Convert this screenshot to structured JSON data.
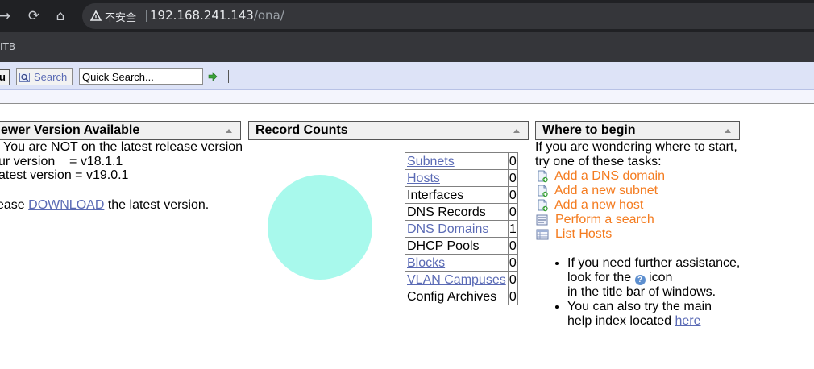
{
  "browser": {
    "nav": {
      "forward_glyph": "→",
      "reload_glyph": "⟳",
      "home_glyph": "⌂"
    },
    "security_label": "不安全",
    "url_host": "192.168.241.143",
    "url_path": "/ona/",
    "bookmark_partial": "ITB"
  },
  "toolbar": {
    "menu_label": "u",
    "search_label": "Search",
    "quick_search_value": "Quick Search..."
  },
  "panels": {
    "newer_version": {
      "title": "ewer Version Available",
      "line1": "You are NOT on the latest release version",
      "line2": "ur version    = v18.1.1",
      "line3": "atest version = v19.0.1",
      "line4_prefix": "ease ",
      "line4_link": "DOWNLOAD",
      "line4_suffix": " the latest version."
    },
    "record_counts": {
      "title": "Record Counts",
      "rows": [
        {
          "name": "Subnets",
          "count": "0",
          "link": true
        },
        {
          "name": "Hosts",
          "count": "0",
          "link": true
        },
        {
          "name": "Interfaces",
          "count": "0",
          "link": false
        },
        {
          "name": "DNS Records",
          "count": "0",
          "link": false
        },
        {
          "name": "DNS Domains",
          "count": "1",
          "link": true
        },
        {
          "name": "DHCP Pools",
          "count": "0",
          "link": false
        },
        {
          "name": "Blocks",
          "count": "0",
          "link": true
        },
        {
          "name": "VLAN Campuses",
          "count": "0",
          "link": true
        },
        {
          "name": "Config Archives",
          "count": "0",
          "link": false
        }
      ]
    },
    "where_to_begin": {
      "title": "Where to begin",
      "intro1": "If you are wondering where to start,",
      "intro2": "try one of these tasks:",
      "tasks": [
        {
          "label": "Add a DNS domain",
          "icon": "add-document-icon"
        },
        {
          "label": "Add a new subnet",
          "icon": "add-document-icon"
        },
        {
          "label": "Add a new host",
          "icon": "add-document-icon"
        },
        {
          "label": "Perform a search",
          "icon": "search-list-icon"
        },
        {
          "label": "List Hosts",
          "icon": "list-table-icon"
        }
      ],
      "help1_a": "If you need further assistance,",
      "help1_b": "look for the ",
      "help1_c": " icon",
      "help1_d": "in the title bar of windows.",
      "help2_a": "You can also try the main",
      "help2_b": "help index located ",
      "help2_link": "here"
    }
  },
  "colors": {
    "toolbar_bg": "#dde3f7",
    "link": "#5b6bb5",
    "task_link": "#f47c20",
    "pie_fill": "#a8f9ec"
  }
}
